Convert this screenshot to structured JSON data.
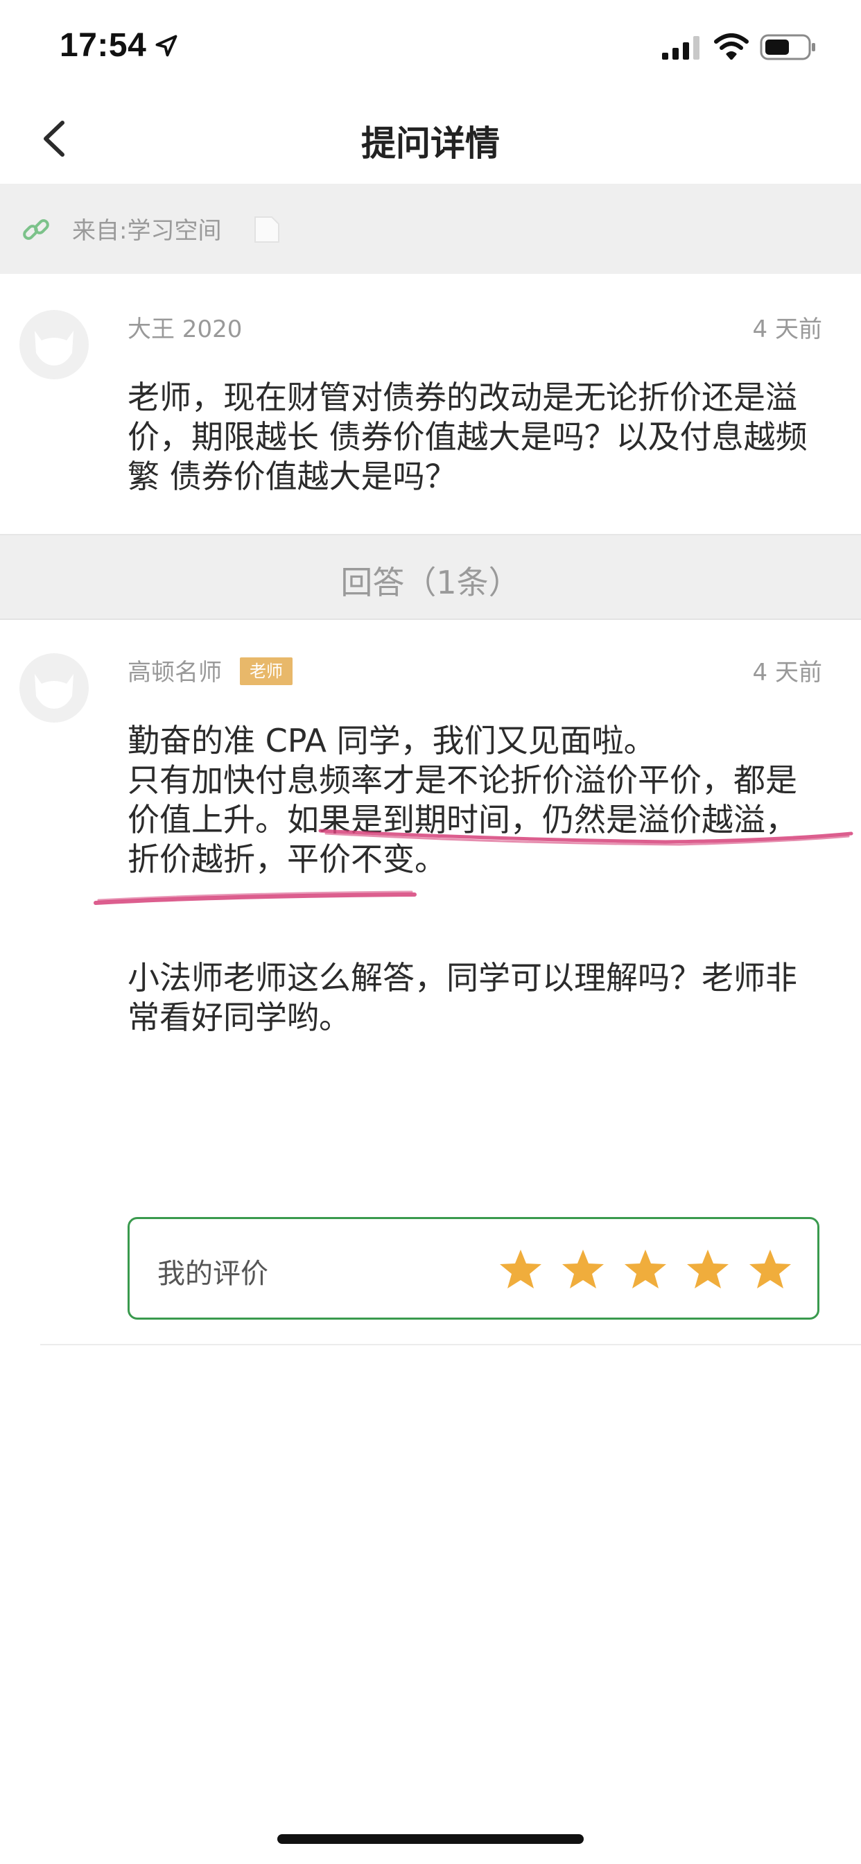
{
  "status_bar": {
    "time": "17:54"
  },
  "nav": {
    "title": "提问详情"
  },
  "source": {
    "label": "来自:学习空间"
  },
  "question": {
    "user": "大王 2020",
    "time": "4 天前",
    "content": "老师，现在财管对债券的改动是无论折价还是溢价，期限越长 债券价值越大是吗？以及付息越频繁 债券价值越大是吗？"
  },
  "answer_header": {
    "label": "回答（1条）"
  },
  "answer": {
    "user": "高顿名师",
    "badge": "老师",
    "time": "4 天前",
    "paragraph1_line1": "勤奋的准 CPA 同学，我们又见面啦。",
    "paragraph1_rest": "只有加快付息频率才是不论折价溢价平价，都是价值上升。如果是到期时间，仍然是溢价越溢，折价越折，平价不变。",
    "paragraph2": "小法师老师这么解答，同学可以理解吗？老师非常看好同学哟。"
  },
  "rating": {
    "label": "我的评价",
    "stars": 5,
    "star_color": "#f0ad3c"
  },
  "colors": {
    "accent_green": "#3a9a4e",
    "badge": "#e8b86a",
    "highlight_pen": "#d6427a"
  }
}
